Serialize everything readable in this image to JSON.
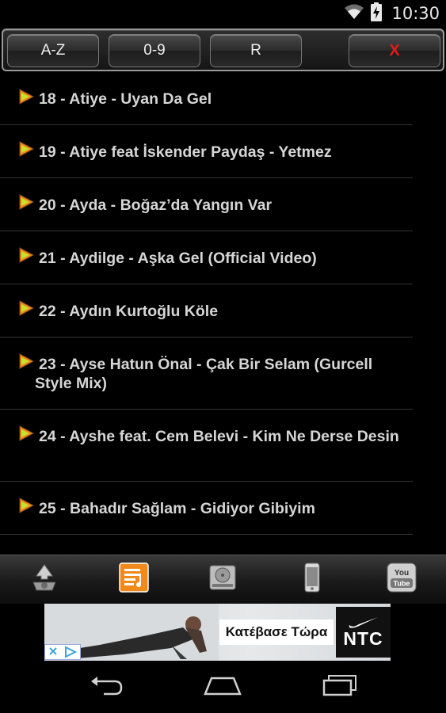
{
  "status_bar": {
    "time": "10:30",
    "wifi_icon": "wifi-icon",
    "battery_icon": "battery-charging-icon"
  },
  "toolbar": {
    "sort_az_label": "A-Z",
    "sort_09_label": "0-9",
    "random_label": "R",
    "close_label": "X"
  },
  "songs": [
    {
      "text": "18 - Atiye - Uyan Da Gel"
    },
    {
      "text": "19 - Atiye feat  İskender Paydaş - Yetmez"
    },
    {
      "text": "20 - Ayda - Boğaz’da Yangın Var"
    },
    {
      "text": "21 - Aydilge - Aşka Gel (Official Video)"
    },
    {
      "text": "22 - Aydın Kurtoğlu   Köle"
    },
    {
      "text": "23 - Ayse Hatun Önal - Çak Bir Selam (Gurcell Style Mix)"
    },
    {
      "text": "24 - Ayshe feat. Cem Belevi - Kim Ne Derse Desin"
    },
    {
      "text": "25 - Bahadır Sağlam - Gidiyor Gibiyim"
    }
  ],
  "tabs": [
    {
      "name": "recycle",
      "icon": "recycle-icon"
    },
    {
      "name": "playlist",
      "icon": "playlist-icon",
      "active": true
    },
    {
      "name": "storage",
      "icon": "hard-drive-icon"
    },
    {
      "name": "phone",
      "icon": "phone-icon"
    },
    {
      "name": "youtube",
      "icon": "youtube-icon",
      "label": "You Tube"
    }
  ],
  "ad": {
    "cta": "Κατέβασε Τώρα",
    "brand": "NTC"
  },
  "colors": {
    "accent": "#f08a1a",
    "close": "#e21b1b",
    "background": "#000000"
  }
}
